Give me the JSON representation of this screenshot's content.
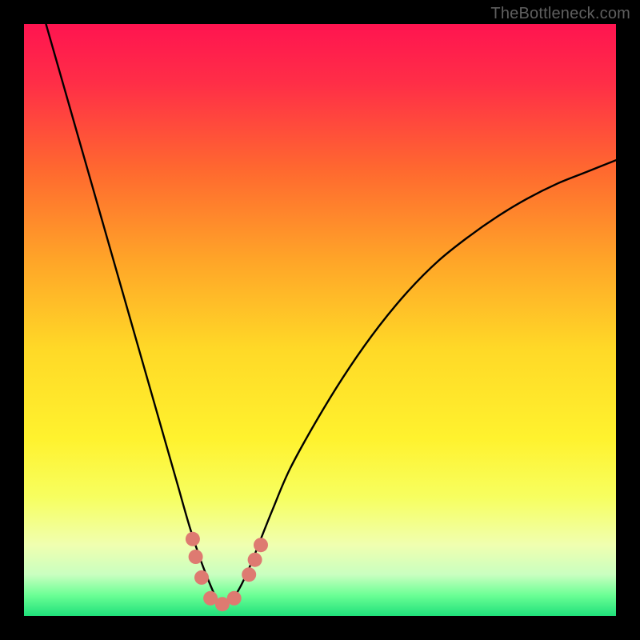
{
  "watermark": {
    "text": "TheBottleneck.com"
  },
  "chart_data": {
    "type": "line",
    "title": "",
    "xlabel": "",
    "ylabel": "",
    "xlim": [
      0,
      100
    ],
    "ylim": [
      0,
      100
    ],
    "gradient_stops": [
      {
        "pos": 0.0,
        "color": "#ff1450"
      },
      {
        "pos": 0.1,
        "color": "#ff2e47"
      },
      {
        "pos": 0.25,
        "color": "#ff6a2f"
      },
      {
        "pos": 0.4,
        "color": "#ffa528"
      },
      {
        "pos": 0.55,
        "color": "#ffd927"
      },
      {
        "pos": 0.7,
        "color": "#fff22e"
      },
      {
        "pos": 0.8,
        "color": "#f7ff60"
      },
      {
        "pos": 0.88,
        "color": "#f0ffb0"
      },
      {
        "pos": 0.93,
        "color": "#c9ffc0"
      },
      {
        "pos": 0.965,
        "color": "#6bff95"
      },
      {
        "pos": 1.0,
        "color": "#1fe07a"
      }
    ],
    "series": [
      {
        "name": "bottleneck-curve",
        "color": "#000000",
        "x": [
          2,
          4,
          6,
          8,
          10,
          12,
          14,
          16,
          18,
          20,
          22,
          24,
          26,
          28,
          30,
          32,
          33,
          34,
          36,
          38,
          40,
          42,
          45,
          50,
          55,
          60,
          65,
          70,
          75,
          80,
          85,
          90,
          95,
          100
        ],
        "y": [
          106,
          99,
          92,
          85,
          78,
          71,
          64,
          57,
          50,
          43,
          36,
          29,
          22,
          15,
          9,
          4,
          2,
          2,
          4,
          8,
          13,
          18,
          25,
          34,
          42,
          49,
          55,
          60,
          64,
          67.5,
          70.5,
          73,
          75,
          77
        ]
      }
    ],
    "markers": {
      "name": "valley-markers",
      "color": "#de7a71",
      "radius": 9,
      "points": [
        {
          "x": 28.5,
          "y": 13
        },
        {
          "x": 29.0,
          "y": 10
        },
        {
          "x": 30.0,
          "y": 6.5
        },
        {
          "x": 31.5,
          "y": 3
        },
        {
          "x": 33.5,
          "y": 2
        },
        {
          "x": 35.5,
          "y": 3
        },
        {
          "x": 38.0,
          "y": 7
        },
        {
          "x": 39.0,
          "y": 9.5
        },
        {
          "x": 40.0,
          "y": 12
        }
      ]
    }
  }
}
